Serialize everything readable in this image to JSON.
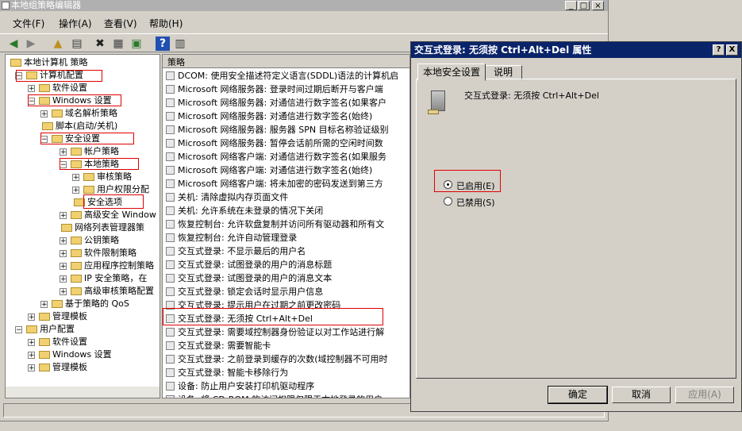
{
  "window": {
    "title": "本地组策略编辑器",
    "min_icon": "minimize-icon",
    "max_icon": "maximize-icon",
    "close_icon": "close-icon"
  },
  "menu": [
    "文件(F)",
    "操作(A)",
    "查看(V)",
    "帮助(H)"
  ],
  "toolbar_icons": [
    "back-arrow-icon",
    "forward-arrow-icon",
    "up-folder-icon",
    "show-hide-tree-icon",
    "delete-icon",
    "properties-icon",
    "export-list-icon",
    "help-icon",
    "view-icon"
  ],
  "tree": [
    {
      "label": "本地计算机 策略",
      "level": 0,
      "exp": ""
    },
    {
      "label": "计算机配置",
      "level": 1,
      "exp": "−"
    },
    {
      "label": "软件设置",
      "level": 2,
      "exp": "+"
    },
    {
      "label": "Windows 设置",
      "level": 2,
      "exp": "−"
    },
    {
      "label": "域名解析策略",
      "level": 3,
      "exp": "+"
    },
    {
      "label": "脚本(启动/关机)",
      "level": 3,
      "exp": ""
    },
    {
      "label": "安全设置",
      "level": 3,
      "exp": "−"
    },
    {
      "label": "帐户策略",
      "level": 4,
      "exp": "+"
    },
    {
      "label": "本地策略",
      "level": 4,
      "exp": "−"
    },
    {
      "label": "审核策略",
      "level": 5,
      "exp": "+"
    },
    {
      "label": "用户权限分配",
      "level": 5,
      "exp": "+"
    },
    {
      "label": "安全选项",
      "level": 5,
      "exp": ""
    },
    {
      "label": "高级安全 Window",
      "level": 4,
      "exp": "+"
    },
    {
      "label": "网络列表管理器策",
      "level": 4,
      "exp": ""
    },
    {
      "label": "公钥策略",
      "level": 4,
      "exp": "+"
    },
    {
      "label": "软件限制策略",
      "level": 4,
      "exp": "+"
    },
    {
      "label": "应用程序控制策略",
      "level": 4,
      "exp": "+"
    },
    {
      "label": "IP 安全策略，在",
      "level": 4,
      "exp": "+"
    },
    {
      "label": "高级审核策略配置",
      "level": 4,
      "exp": "+"
    },
    {
      "label": "基于策略的 QoS",
      "level": 3,
      "exp": "+"
    },
    {
      "label": "管理模板",
      "level": 2,
      "exp": "+"
    },
    {
      "label": "用户配置",
      "level": 1,
      "exp": "−"
    },
    {
      "label": "软件设置",
      "level": 2,
      "exp": "+"
    },
    {
      "label": "Windows 设置",
      "level": 2,
      "exp": "+"
    },
    {
      "label": "管理模板",
      "level": 2,
      "exp": "+"
    }
  ],
  "list": {
    "header": "策略",
    "rows": [
      "DCOM: 使用安全描述符定义语言(SDDL)语法的计算机启",
      "Microsoft 网络服务器: 登录时间过期后断开与客户端",
      "Microsoft 网络服务器: 对通信进行数字签名(如果客户",
      "Microsoft 网络服务器: 对通信进行数字签名(始终)",
      "Microsoft 网络服务器: 服务器 SPN 目标名称验证级别",
      "Microsoft 网络服务器: 暂停会话前所需的空闲时间数",
      "Microsoft 网络客户端: 对通信进行数字签名(如果服务",
      "Microsoft 网络客户端: 对通信进行数字签名(始终)",
      "Microsoft 网络客户端: 将未加密的密码发送到第三方",
      "关机: 清除虚拟内存页面文件",
      "关机: 允许系统在未登录的情况下关闭",
      "恢复控制台: 允许软盘复制并访问所有驱动器和所有文",
      "恢复控制台: 允许自动管理登录",
      "交互式登录: 不显示最后的用户名",
      "交互式登录: 试图登录的用户的消息标题",
      "交互式登录: 试图登录的用户的消息文本",
      "交互式登录: 锁定会话时显示用户信息",
      "交互式登录: 提示用户在过期之前更改密码",
      "交互式登录: 无须按 Ctrl+Alt+Del",
      "交互式登录: 需要域控制器身份验证以对工作站进行解",
      "交互式登录: 需要智能卡",
      "交互式登录: 之前登录到缓存的次数(域控制器不可用时",
      "交互式登录: 智能卡移除行为",
      "设备: 防止用户安装打印机驱动程序",
      "设备: 将 CD-ROM 的访问权限仅限于本地登录的用户"
    ]
  },
  "dialog": {
    "title": "交互式登录: 无须按 Ctrl+Alt+Del 属性",
    "help_label": "?",
    "close_label": "X",
    "tabs": [
      "本地安全设置",
      "说明"
    ],
    "policy_name": "交互式登录: 无须按 Ctrl+Alt+Del",
    "options": [
      "已启用(E)",
      "已禁用(S)"
    ],
    "selected": "已启用(E)",
    "buttons": {
      "ok": "确定",
      "cancel": "取消",
      "apply": "应用(A)"
    }
  }
}
